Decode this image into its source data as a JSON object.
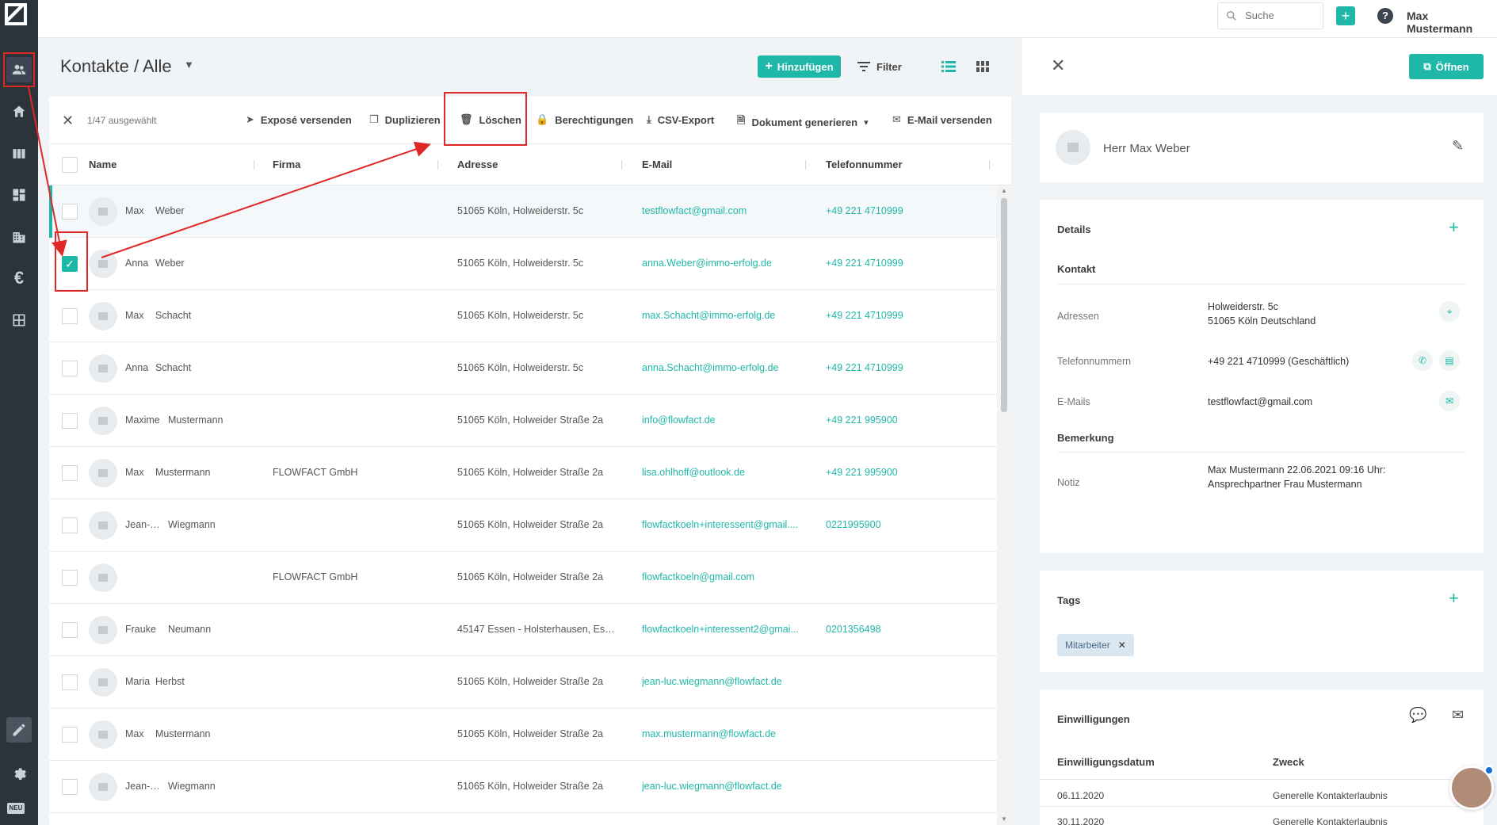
{
  "topbar": {
    "search_placeholder": "Suche",
    "add_label": "+",
    "help_label": "?",
    "user_name": "Max Mustermann"
  },
  "list": {
    "title": "Kontakte / Alle",
    "add_label": "Hinzufügen",
    "filter_label": "Filter",
    "selected_count": "1/47 ausgewählt",
    "actions": {
      "expose": "Exposé versenden",
      "duplicate": "Duplizieren",
      "delete": "Löschen",
      "permissions": "Berechtigungen",
      "csv": "CSV-Export",
      "document": "Dokument generieren",
      "email": "E-Mail versenden"
    },
    "columns": {
      "name": "Name",
      "company": "Firma",
      "address": "Adresse",
      "email": "E-Mail",
      "phone": "Telefonnummer"
    },
    "rows": [
      {
        "first": "Max",
        "last": "Weber",
        "company": "",
        "address": "51065 Köln, Holweiderstr. 5c",
        "email": "testflowfact@gmail.com",
        "phone": "+49 221 4710999",
        "checked": false,
        "active": true
      },
      {
        "first": "Anna",
        "last": "Weber",
        "company": "",
        "address": "51065 Köln, Holweiderstr. 5c",
        "email": "anna.Weber@immo-erfolg.de",
        "phone": "+49 221 4710999",
        "checked": true,
        "active": false
      },
      {
        "first": "Max",
        "last": "Schacht",
        "company": "",
        "address": "51065 Köln, Holweiderstr. 5c",
        "email": "max.Schacht@immo-erfolg.de",
        "phone": "+49 221 4710999",
        "checked": false,
        "active": false
      },
      {
        "first": "Anna",
        "last": "Schacht",
        "company": "",
        "address": "51065 Köln, Holweiderstr. 5c",
        "email": "anna.Schacht@immo-erfolg.de",
        "phone": "+49 221 4710999",
        "checked": false,
        "active": false
      },
      {
        "first": "Maxime",
        "last": "Mustermann",
        "company": "",
        "address": "51065 Köln, Holweider Straße 2a",
        "email": "info@flowfact.de",
        "phone": "+49 221 995900",
        "checked": false,
        "active": false
      },
      {
        "first": "Max",
        "last": "Mustermann",
        "company": "FLOWFACT GmbH",
        "address": "51065 Köln, Holweider Straße 2a",
        "email": "lisa.ohlhoff@outlook.de",
        "phone": "+49 221 995900",
        "checked": false,
        "active": false
      },
      {
        "first": "Jean-Luc",
        "last": "Wiegmann",
        "company": "",
        "address": "51065 Köln, Holweider Straße 2a",
        "email": "flowfactkoeln+interessent@gmail....",
        "phone": "0221995900",
        "checked": false,
        "active": false
      },
      {
        "first": "",
        "last": "",
        "company": "FLOWFACT GmbH",
        "address": "51065 Köln, Holweider Straße 2a",
        "email": "flowfactkoeln@gmail.com",
        "phone": "",
        "checked": false,
        "active": false
      },
      {
        "first": "Frauke",
        "last": "Neumann",
        "company": "",
        "address": "45147 Essen - Holsterhausen, Ess...",
        "email": "flowfactkoeln+interessent2@gmai...",
        "phone": "0201356498",
        "checked": false,
        "active": false
      },
      {
        "first": "Maria",
        "last": "Herbst",
        "company": "",
        "address": "51065 Köln, Holweider Straße 2a",
        "email": "jean-luc.wiegmann@flowfact.de",
        "phone": "",
        "checked": false,
        "active": false
      },
      {
        "first": "Max",
        "last": "Mustermann",
        "company": "",
        "address": "51065 Köln, Holweider Straße 2a",
        "email": "max.mustermann@flowfact.de",
        "phone": "",
        "checked": false,
        "active": false
      },
      {
        "first": "Jean-Luc",
        "last": "Wiegmann",
        "company": "",
        "address": "51065 Köln, Holweider Straße 2a",
        "email": "jean-luc.wiegmann@flowfact.de",
        "phone": "",
        "checked": false,
        "active": false
      }
    ]
  },
  "detail": {
    "open_label": "Öffnen",
    "contact_name": "Herr Max Weber",
    "details_title": "Details",
    "kontakt_title": "Kontakt",
    "addresses_label": "Adressen",
    "address_line1": "Holweiderstr. 5c",
    "address_line2": "51065  Köln  Deutschland",
    "phones_label": "Telefonnummern",
    "phone_value": "+49 221 4710999  (Geschäftlich)",
    "emails_label": "E-Mails",
    "email_value": "testflowfact@gmail.com",
    "remark_title": "Bemerkung",
    "note_label": "Notiz",
    "note_line1": "Max Mustermann 22.06.2021 09:16 Uhr:",
    "note_line2": "Ansprechpartner Frau Mustermann",
    "tags_title": "Tags",
    "tag_value": "Mitarbeiter",
    "consent_title": "Einwilligungen",
    "consent_col_date": "Einwilligungsdatum",
    "consent_col_purpose": "Zweck",
    "consent_rows": [
      {
        "date": "06.11.2020",
        "purpose": "Generelle Kontakterlaubnis"
      },
      {
        "date": "30.11.2020",
        "purpose": "Generelle Kontakterlaubnis"
      }
    ]
  },
  "sidebar": {
    "neu_label": "NEU"
  },
  "colors": {
    "accent": "#1fb8a8",
    "sidebar": "#2b333b",
    "annotation": "#e02828"
  }
}
